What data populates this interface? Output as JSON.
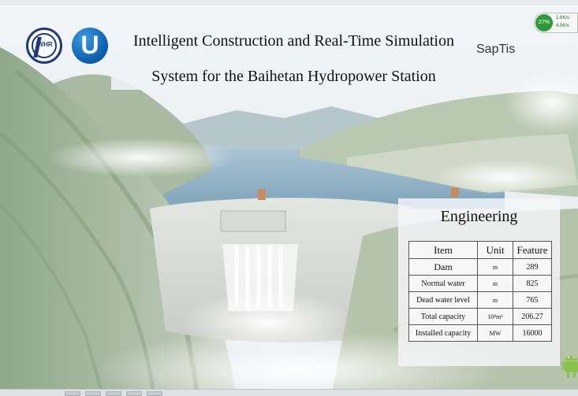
{
  "header": {
    "title_line1": "Intelligent Construction and Real-Time Simulation",
    "title_line2": "System for the Baihetan Hydropower Station",
    "logo_left_text": "IWHR",
    "logo_right_text": "U",
    "brand": "SapTis"
  },
  "status_widget": {
    "percent": "27%",
    "upload": "1.6K/s",
    "download": "4.5K/s"
  },
  "engineering": {
    "title": "Engineering",
    "columns": [
      "Item",
      "Unit",
      "Feature"
    ],
    "rows": [
      {
        "item": "Dam",
        "unit": "m",
        "feature": "289"
      },
      {
        "item": "Normal water",
        "unit": "m",
        "feature": "825"
      },
      {
        "item": "Dead water level",
        "unit": "m",
        "feature": "765"
      },
      {
        "item": "Total capacity",
        "unit": "10⁸m³",
        "feature": "206.27"
      },
      {
        "item": "Installed capacity",
        "unit": "MW",
        "feature": "16000"
      }
    ]
  },
  "colors": {
    "accent_blue": "#1e3a7e",
    "logo_blue": "#0c5fb0",
    "widget_green": "#2f9a3b",
    "android_green": "#8bc34a"
  },
  "icons": {
    "logo_left": "iwhr-logo",
    "logo_right": "u-logo",
    "corner": "android-icon"
  }
}
